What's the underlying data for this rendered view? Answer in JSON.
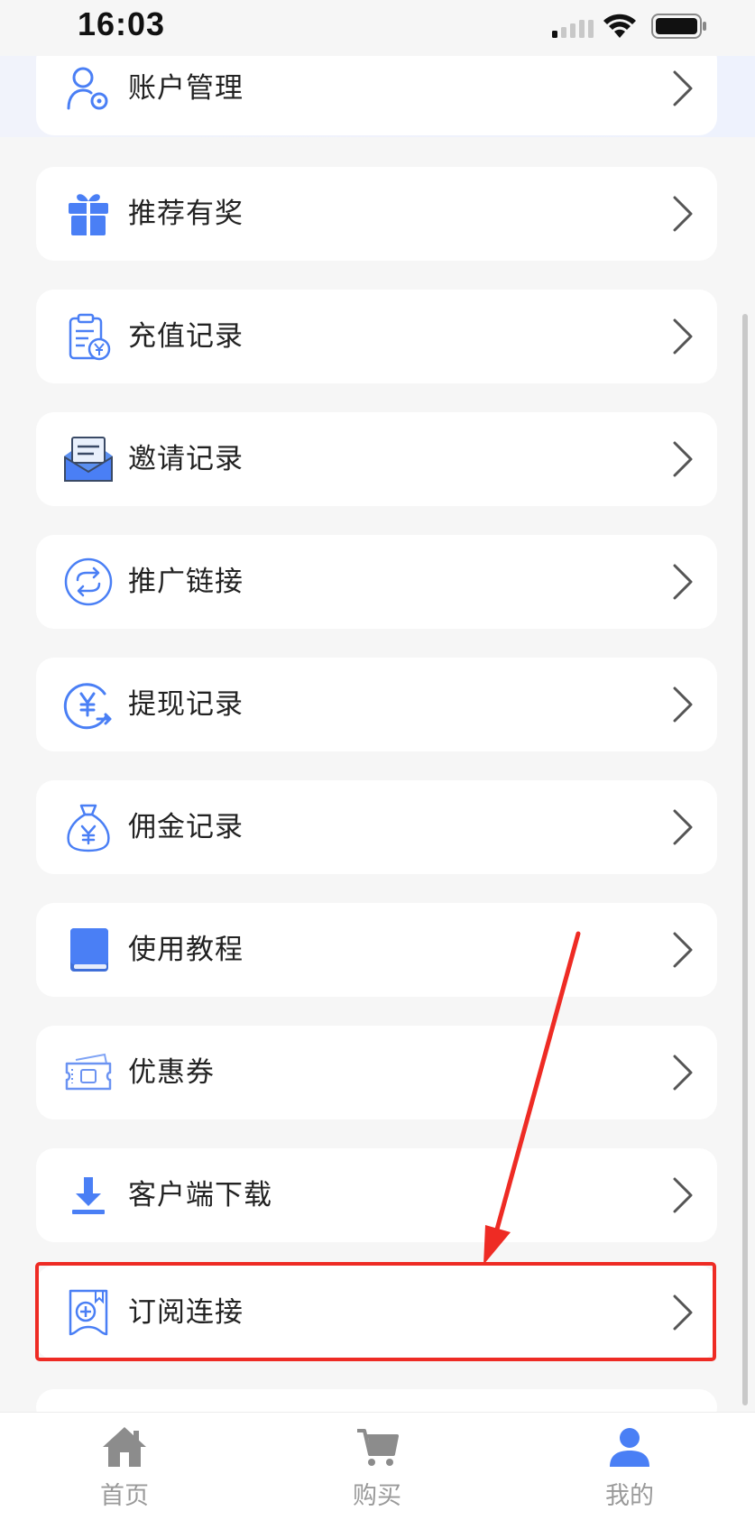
{
  "status_bar": {
    "time": "16:03"
  },
  "menu": {
    "items": [
      {
        "label": "账户管理",
        "icon": "user-settings-icon"
      },
      {
        "label": "推荐有奖",
        "icon": "gift-icon"
      },
      {
        "label": "充值记录",
        "icon": "recharge-receipt-icon"
      },
      {
        "label": "邀请记录",
        "icon": "invitation-envelope-icon"
      },
      {
        "label": "推广链接",
        "icon": "promo-link-icon"
      },
      {
        "label": "提现记录",
        "icon": "withdraw-icon"
      },
      {
        "label": "佣金记录",
        "icon": "money-bag-icon"
      },
      {
        "label": "使用教程",
        "icon": "book-icon"
      },
      {
        "label": "优惠券",
        "icon": "coupon-icon"
      },
      {
        "label": "客户端下载",
        "icon": "download-icon"
      },
      {
        "label": "订阅连接",
        "icon": "subscription-icon"
      }
    ],
    "highlighted_index": 10
  },
  "tab_bar": {
    "tabs": [
      {
        "label": "首页",
        "icon": "home-icon"
      },
      {
        "label": "购买",
        "icon": "cart-icon"
      },
      {
        "label": "我的",
        "icon": "user-icon"
      }
    ],
    "active_index": 2
  },
  "colors": {
    "accent_blue": "#4a7ff5",
    "highlight_red": "#ee2b24",
    "background": "#f6f6f6",
    "tab_gray": "#9a9a9a"
  }
}
